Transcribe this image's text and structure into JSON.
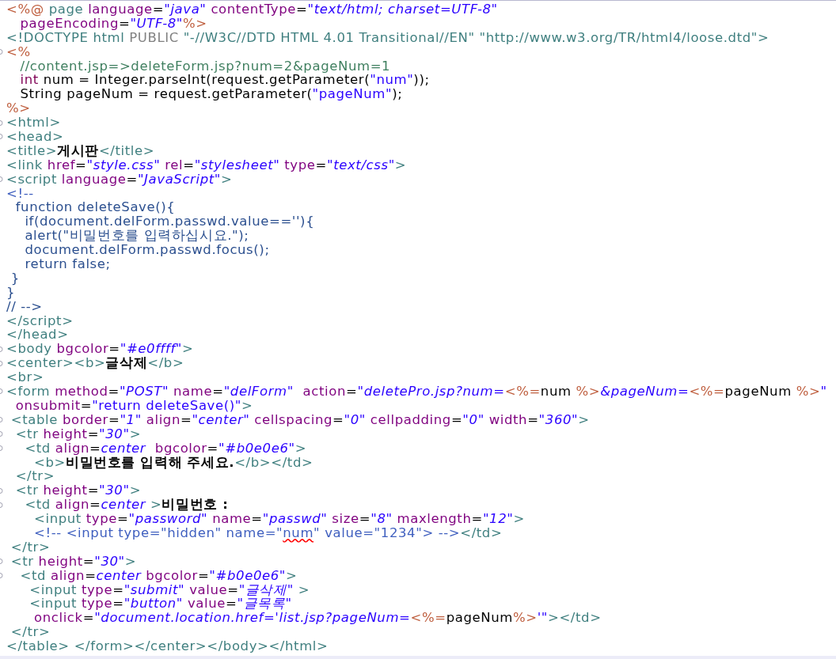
{
  "editor": {
    "lines": [
      {
        "fold": false,
        "tokens": [
          {
            "kind": "jsp",
            "text": "<%@"
          },
          {
            "kind": "tag",
            "text": " page"
          },
          {
            "kind": "attr",
            "text": " language"
          },
          {
            "kind": "op",
            "text": "="
          },
          {
            "kind": "val",
            "text": "\"java\""
          },
          {
            "kind": "attr",
            "text": " contentType"
          },
          {
            "kind": "op",
            "text": "="
          },
          {
            "kind": "val",
            "text": "\"text/html; charset=UTF-8\""
          }
        ]
      },
      {
        "fold": false,
        "tokens": [
          {
            "kind": "attr",
            "text": "   pageEncoding"
          },
          {
            "kind": "op",
            "text": "="
          },
          {
            "kind": "val",
            "text": "\"UTF-8\""
          },
          {
            "kind": "jsp",
            "text": "%>"
          }
        ]
      },
      {
        "fold": false,
        "tokens": [
          {
            "kind": "tag",
            "text": "<!DOCTYPE html"
          },
          {
            "kind": "doc",
            "text": " PUBLIC "
          },
          {
            "kind": "tag",
            "text": "\"-//W3C//DTD HTML 4.01 Transitional//EN\" \"http://www.w3.org/TR/html4/loose.dtd\">"
          }
        ]
      },
      {
        "fold": true,
        "tokens": [
          {
            "kind": "jsp",
            "text": "<%"
          }
        ]
      },
      {
        "fold": false,
        "tokens": [
          {
            "kind": "jcomment",
            "text": "   //content.jsp=>deleteForm.jsp?num=2&pageNum=1"
          }
        ]
      },
      {
        "fold": false,
        "tokens": [
          {
            "kind": "kw",
            "text": "   int"
          },
          {
            "kind": "text",
            "text": " num = Integer.parseInt(request.getParameter("
          },
          {
            "kind": "str",
            "text": "\"num\""
          },
          {
            "kind": "text",
            "text": "));"
          }
        ]
      },
      {
        "fold": false,
        "tokens": [
          {
            "kind": "text",
            "text": "   String pageNum = request.getParameter("
          },
          {
            "kind": "str",
            "text": "\"pageNum\""
          },
          {
            "kind": "text",
            "text": ");"
          }
        ]
      },
      {
        "fold": false,
        "tokens": [
          {
            "kind": "jsp",
            "text": "%>"
          }
        ]
      },
      {
        "fold": true,
        "tokens": [
          {
            "kind": "tag",
            "text": "<html>"
          }
        ]
      },
      {
        "fold": true,
        "tokens": [
          {
            "kind": "tag",
            "text": "<head>"
          }
        ]
      },
      {
        "fold": false,
        "tokens": [
          {
            "kind": "tag",
            "text": "<title>"
          },
          {
            "kind": "content",
            "text": "게시판"
          },
          {
            "kind": "tag",
            "text": "</title>"
          }
        ]
      },
      {
        "fold": false,
        "tokens": [
          {
            "kind": "tag",
            "text": "<link"
          },
          {
            "kind": "attr",
            "text": " href"
          },
          {
            "kind": "op",
            "text": "="
          },
          {
            "kind": "val",
            "text": "\"style.css\""
          },
          {
            "kind": "attr",
            "text": " rel"
          },
          {
            "kind": "op",
            "text": "="
          },
          {
            "kind": "val",
            "text": "\"stylesheet\""
          },
          {
            "kind": "attr",
            "text": " type"
          },
          {
            "kind": "op",
            "text": "="
          },
          {
            "kind": "val",
            "text": "\"text/css\""
          },
          {
            "kind": "tag",
            "text": ">"
          }
        ]
      },
      {
        "fold": true,
        "tokens": [
          {
            "kind": "tag",
            "text": "<script"
          },
          {
            "kind": "attr",
            "text": " language"
          },
          {
            "kind": "op",
            "text": "="
          },
          {
            "kind": "val",
            "text": "\"JavaScript\""
          },
          {
            "kind": "tag",
            "text": ">"
          }
        ]
      },
      {
        "fold": false,
        "tokens": [
          {
            "kind": "comment",
            "text": "<!--"
          }
        ]
      },
      {
        "fold": false,
        "tokens": [
          {
            "kind": "script",
            "text": "  function deleteSave(){"
          }
        ]
      },
      {
        "fold": false,
        "tokens": [
          {
            "kind": "script",
            "text": "    if(document.delForm.passwd.value==''){"
          }
        ]
      },
      {
        "fold": false,
        "tokens": [
          {
            "kind": "script",
            "text": "    alert(\"비밀번호를 입력하십시요.\");"
          }
        ]
      },
      {
        "fold": false,
        "tokens": [
          {
            "kind": "script",
            "text": "    document.delForm.passwd.focus();"
          }
        ]
      },
      {
        "fold": false,
        "tokens": [
          {
            "kind": "script",
            "text": "    return false;"
          }
        ]
      },
      {
        "fold": false,
        "tokens": [
          {
            "kind": "script",
            "text": " }"
          }
        ]
      },
      {
        "fold": false,
        "tokens": [
          {
            "kind": "script",
            "text": "}"
          }
        ]
      },
      {
        "fold": false,
        "tokens": [
          {
            "kind": "script",
            "text": "// -->"
          }
        ]
      },
      {
        "fold": false,
        "tokens": [
          {
            "kind": "tag",
            "text": "</script>"
          }
        ]
      },
      {
        "fold": false,
        "tokens": [
          {
            "kind": "tag",
            "text": "</head>"
          }
        ]
      },
      {
        "fold": true,
        "tokens": [
          {
            "kind": "tag",
            "text": "<body"
          },
          {
            "kind": "attr",
            "text": " bgcolor"
          },
          {
            "kind": "op",
            "text": "="
          },
          {
            "kind": "val",
            "text": "\"#e0ffff\""
          },
          {
            "kind": "tag",
            "text": ">"
          }
        ]
      },
      {
        "fold": true,
        "tokens": [
          {
            "kind": "tag",
            "text": "<center><b>"
          },
          {
            "kind": "content",
            "text": "글삭제"
          },
          {
            "kind": "tag",
            "text": "</b>"
          }
        ]
      },
      {
        "fold": false,
        "tokens": [
          {
            "kind": "tag",
            "text": "<br>"
          }
        ]
      },
      {
        "fold": true,
        "tokens": [
          {
            "kind": "tag",
            "text": "<form"
          },
          {
            "kind": "attr",
            "text": " method"
          },
          {
            "kind": "op",
            "text": "="
          },
          {
            "kind": "val",
            "text": "\"POST\""
          },
          {
            "kind": "attr",
            "text": " name"
          },
          {
            "kind": "op",
            "text": "="
          },
          {
            "kind": "val",
            "text": "\"delForm\""
          },
          {
            "kind": "attr",
            "text": "  action"
          },
          {
            "kind": "op",
            "text": "="
          },
          {
            "kind": "val",
            "text": "\"deletePro.jsp?num="
          },
          {
            "kind": "jsp",
            "text": "<%="
          },
          {
            "kind": "text",
            "text": "num "
          },
          {
            "kind": "jsp",
            "text": "%>"
          },
          {
            "kind": "val",
            "text": "&pageNum="
          },
          {
            "kind": "jsp",
            "text": "<%="
          },
          {
            "kind": "text",
            "text": "pageNum "
          },
          {
            "kind": "jsp",
            "text": "%>"
          },
          {
            "kind": "val",
            "text": "\""
          }
        ]
      },
      {
        "fold": false,
        "tokens": [
          {
            "kind": "attr",
            "text": "  onsubmit"
          },
          {
            "kind": "op",
            "text": "="
          },
          {
            "kind": "str",
            "text": "\"return deleteSave()\""
          },
          {
            "kind": "tag",
            "text": ">"
          }
        ]
      },
      {
        "fold": true,
        "tokens": [
          {
            "kind": "tag",
            "text": " <table"
          },
          {
            "kind": "attr",
            "text": " border"
          },
          {
            "kind": "op",
            "text": "="
          },
          {
            "kind": "val",
            "text": "\"1\""
          },
          {
            "kind": "attr",
            "text": " align"
          },
          {
            "kind": "op",
            "text": "="
          },
          {
            "kind": "val",
            "text": "\"center\""
          },
          {
            "kind": "attr",
            "text": " cellspacing"
          },
          {
            "kind": "op",
            "text": "="
          },
          {
            "kind": "val",
            "text": "\"0\""
          },
          {
            "kind": "attr",
            "text": " cellpadding"
          },
          {
            "kind": "op",
            "text": "="
          },
          {
            "kind": "val",
            "text": "\"0\""
          },
          {
            "kind": "attr",
            "text": " width"
          },
          {
            "kind": "op",
            "text": "="
          },
          {
            "kind": "val",
            "text": "\"360\""
          },
          {
            "kind": "tag",
            "text": ">"
          }
        ]
      },
      {
        "fold": true,
        "tokens": [
          {
            "kind": "tag",
            "text": "  <tr"
          },
          {
            "kind": "attr",
            "text": " height"
          },
          {
            "kind": "op",
            "text": "="
          },
          {
            "kind": "val",
            "text": "\"30\""
          },
          {
            "kind": "tag",
            "text": ">"
          }
        ]
      },
      {
        "fold": true,
        "tokens": [
          {
            "kind": "tag",
            "text": "    <td"
          },
          {
            "kind": "attr",
            "text": " align"
          },
          {
            "kind": "op",
            "text": "="
          },
          {
            "kind": "val",
            "text": "center"
          },
          {
            "kind": "attr",
            "text": "  bgcolor"
          },
          {
            "kind": "op",
            "text": "="
          },
          {
            "kind": "val",
            "text": "\"#b0e0e6\""
          },
          {
            "kind": "tag",
            "text": ">"
          }
        ]
      },
      {
        "fold": false,
        "tokens": [
          {
            "kind": "tag",
            "text": "      <b>"
          },
          {
            "kind": "content",
            "text": "비밀번호를 입력해 주세요."
          },
          {
            "kind": "tag",
            "text": "</b></td>"
          }
        ]
      },
      {
        "fold": false,
        "tokens": [
          {
            "kind": "tag",
            "text": "  </tr>"
          }
        ]
      },
      {
        "fold": true,
        "tokens": [
          {
            "kind": "tag",
            "text": "  <tr"
          },
          {
            "kind": "attr",
            "text": " height"
          },
          {
            "kind": "op",
            "text": "="
          },
          {
            "kind": "val",
            "text": "\"30\""
          },
          {
            "kind": "tag",
            "text": ">"
          }
        ]
      },
      {
        "fold": true,
        "tokens": [
          {
            "kind": "tag",
            "text": "    <td"
          },
          {
            "kind": "attr",
            "text": " align"
          },
          {
            "kind": "op",
            "text": "="
          },
          {
            "kind": "val",
            "text": "center"
          },
          {
            "kind": "tag",
            "text": " >"
          },
          {
            "kind": "content",
            "text": "비밀번호 :"
          }
        ]
      },
      {
        "fold": false,
        "tokens": [
          {
            "kind": "tag",
            "text": "      <input"
          },
          {
            "kind": "attr",
            "text": " type"
          },
          {
            "kind": "op",
            "text": "="
          },
          {
            "kind": "val",
            "text": "\"password\""
          },
          {
            "kind": "attr",
            "text": " name"
          },
          {
            "kind": "op",
            "text": "="
          },
          {
            "kind": "val",
            "text": "\"passwd\""
          },
          {
            "kind": "attr",
            "text": " size"
          },
          {
            "kind": "op",
            "text": "="
          },
          {
            "kind": "val",
            "text": "\"8\""
          },
          {
            "kind": "attr",
            "text": " maxlength"
          },
          {
            "kind": "op",
            "text": "="
          },
          {
            "kind": "val",
            "text": "\"12\""
          },
          {
            "kind": "tag",
            "text": ">"
          }
        ]
      },
      {
        "fold": false,
        "tokens": [
          {
            "kind": "comment",
            "text": "      <!-- <input type=\"hidden\" name=\""
          },
          {
            "kind": "comment_flagged",
            "text": "num"
          },
          {
            "kind": "comment",
            "text": "\" value=\"1234\"> -->"
          },
          {
            "kind": "tag",
            "text": "</td>"
          }
        ]
      },
      {
        "fold": false,
        "tokens": [
          {
            "kind": "tag",
            "text": " </tr>"
          }
        ]
      },
      {
        "fold": true,
        "tokens": [
          {
            "kind": "tag",
            "text": " <tr"
          },
          {
            "kind": "attr",
            "text": " height"
          },
          {
            "kind": "op",
            "text": "="
          },
          {
            "kind": "val",
            "text": "\"30\""
          },
          {
            "kind": "tag",
            "text": ">"
          }
        ]
      },
      {
        "fold": true,
        "tokens": [
          {
            "kind": "tag",
            "text": "   <td"
          },
          {
            "kind": "attr",
            "text": " align"
          },
          {
            "kind": "op",
            "text": "="
          },
          {
            "kind": "val",
            "text": "center"
          },
          {
            "kind": "attr",
            "text": " bgcolor"
          },
          {
            "kind": "op",
            "text": "="
          },
          {
            "kind": "val",
            "text": "\"#b0e0e6\""
          },
          {
            "kind": "tag",
            "text": ">"
          }
        ]
      },
      {
        "fold": false,
        "tokens": [
          {
            "kind": "tag",
            "text": "     <input"
          },
          {
            "kind": "attr",
            "text": " type"
          },
          {
            "kind": "op",
            "text": "="
          },
          {
            "kind": "val",
            "text": "\"submit\""
          },
          {
            "kind": "attr",
            "text": " value"
          },
          {
            "kind": "op",
            "text": "="
          },
          {
            "kind": "val",
            "text": "\"글삭제\""
          },
          {
            "kind": "tag",
            "text": " >"
          }
        ]
      },
      {
        "fold": false,
        "tokens": [
          {
            "kind": "tag",
            "text": "     <input"
          },
          {
            "kind": "attr",
            "text": " type"
          },
          {
            "kind": "op",
            "text": "="
          },
          {
            "kind": "val",
            "text": "\"button\""
          },
          {
            "kind": "attr",
            "text": " value"
          },
          {
            "kind": "op",
            "text": "="
          },
          {
            "kind": "val",
            "text": "\"글목록\""
          }
        ]
      },
      {
        "fold": false,
        "tokens": [
          {
            "kind": "attr",
            "text": "      onclick"
          },
          {
            "kind": "op",
            "text": "="
          },
          {
            "kind": "val",
            "text": "\"document.location.href='list.jsp?pageNum="
          },
          {
            "kind": "jsp",
            "text": "<%="
          },
          {
            "kind": "text",
            "text": "pageNum"
          },
          {
            "kind": "jsp",
            "text": "%>"
          },
          {
            "kind": "val",
            "text": "'\""
          },
          {
            "kind": "tag",
            "text": "></td>"
          }
        ]
      },
      {
        "fold": false,
        "tokens": [
          {
            "kind": "tag",
            "text": " </tr>"
          }
        ]
      },
      {
        "fold": false,
        "tokens": [
          {
            "kind": "tag",
            "text": "</table> </form></center></body></html>"
          }
        ]
      }
    ]
  }
}
